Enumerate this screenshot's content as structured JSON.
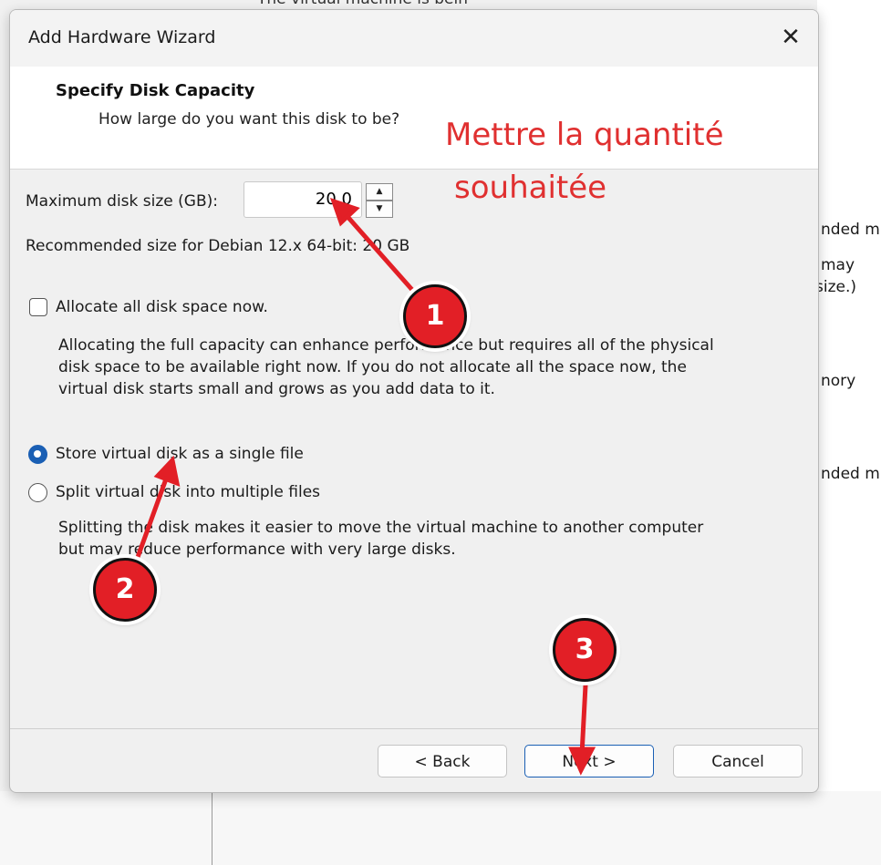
{
  "background": {
    "top_fragment": "The virtual machine is bein",
    "right_fragments": [
      "nded m",
      "may",
      "size.)",
      "nory",
      "nded m"
    ]
  },
  "dialog": {
    "title": "Add Hardware Wizard",
    "close_label": "✕",
    "header_title": "Specify Disk Capacity",
    "header_subtitle": "How large do you want this disk to be?",
    "max_size_label": "Maximum disk size (GB):",
    "max_size_value": "20.0",
    "recommended": "Recommended size for Debian 12.x 64-bit: 20 GB",
    "allocate_label": "Allocate all disk space now.",
    "allocate_checked": false,
    "allocate_desc": [
      "Allocating the full capacity can enhance performance but requires all of the physical",
      "disk space to be available right now. If you do not allocate all the space now, the",
      "virtual disk starts small and grows as you add data to it."
    ],
    "single_file_label": "Store virtual disk as a single file",
    "single_file_selected": true,
    "split_label": "Split virtual disk into multiple files",
    "split_desc": [
      "Splitting the disk makes it easier to move the virtual machine to another computer",
      "but may reduce performance with very large disks."
    ],
    "buttons": {
      "back": "< Back",
      "next": "Next >",
      "cancel": "Cancel"
    }
  },
  "annotations": {
    "text_line1": "Mettre la quantité",
    "text_line2": "souhaitée",
    "badges": [
      "1",
      "2",
      "3"
    ],
    "color": "#e21f26"
  }
}
